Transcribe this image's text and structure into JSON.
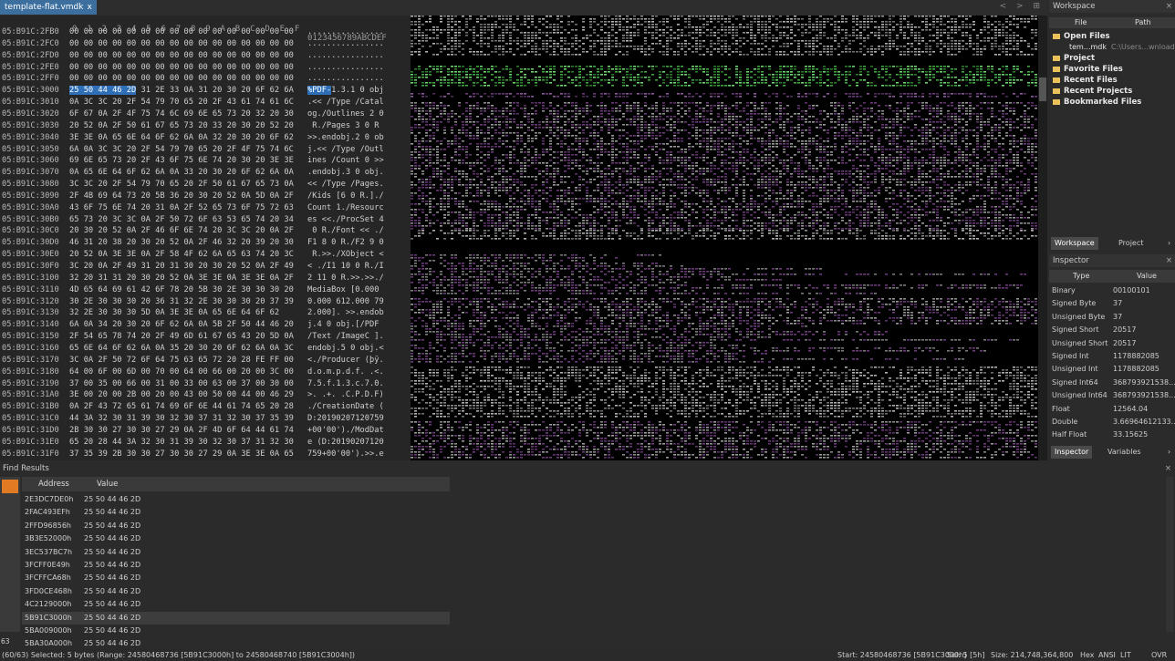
{
  "tab": {
    "title": "template-flat.vmdk",
    "close": "x"
  },
  "tab_nav": "< > ⊞",
  "editor": {
    "col_header_hex": "0  1  2  3  4  5  6  7  8  9  A  B  C  D  E  F",
    "col_header_ascii": "0123456789ABCDEF",
    "rows": [
      {
        "addr": "05:B91C:2FB0",
        "hex": "00 00 00 00 00 00 00 00 00 00 00 00 00 00 00 00",
        "ascii": "................"
      },
      {
        "addr": "05:B91C:2FC0",
        "hex": "00 00 00 00 00 00 00 00 00 00 00 00 00 00 00 00",
        "ascii": "................"
      },
      {
        "addr": "05:B91C:2FD0",
        "hex": "00 00 00 00 00 00 00 00 00 00 00 00 00 00 00 00",
        "ascii": "................"
      },
      {
        "addr": "05:B91C:2FE0",
        "hex": "00 00 00 00 00 00 00 00 00 00 00 00 00 00 00 00",
        "ascii": "................"
      },
      {
        "addr": "05:B91C:2FF0",
        "hex": "00 00 00 00 00 00 00 00 00 00 00 00 00 00 00 00",
        "ascii": "................"
      },
      {
        "addr": "05:B91C:3000",
        "hex_sel": "25 50 44 46 2D",
        "hex": " 31 2E 33 0A 31 20 30 20 6F 62 6A",
        "ascii_sel": "%PDF-",
        "ascii": "1.3.1 0 obj"
      },
      {
        "addr": "05:B91C:3010",
        "hex": "0A 3C 3C 20 2F 54 79 70 65 20 2F 43 61 74 61 6C",
        "ascii": ".<< /Type /Catal"
      },
      {
        "addr": "05:B91C:3020",
        "hex": "6F 67 0A 2F 4F 75 74 6C 69 6E 65 73 20 32 20 30",
        "ascii": "og./Outlines 2 0"
      },
      {
        "addr": "05:B91C:3030",
        "hex": "20 52 0A 2F 50 61 67 65 73 20 33 20 30 20 52 20",
        "ascii": " R./Pages 3 0 R "
      },
      {
        "addr": "05:B91C:3040",
        "hex": "3E 3E 0A 65 6E 64 6F 62 6A 0A 32 20 30 20 6F 62",
        "ascii": ">>.endobj.2 0 ob"
      },
      {
        "addr": "05:B91C:3050",
        "hex": "6A 0A 3C 3C 20 2F 54 79 70 65 20 2F 4F 75 74 6C",
        "ascii": "j.<< /Type /Outl"
      },
      {
        "addr": "05:B91C:3060",
        "hex": "69 6E 65 73 20 2F 43 6F 75 6E 74 20 30 20 3E 3E",
        "ascii": "ines /Count 0 >>"
      },
      {
        "addr": "05:B91C:3070",
        "hex": "0A 65 6E 64 6F 62 6A 0A 33 20 30 20 6F 62 6A 0A",
        "ascii": ".endobj.3 0 obj."
      },
      {
        "addr": "05:B91C:3080",
        "hex": "3C 3C 20 2F 54 79 70 65 20 2F 50 61 67 65 73 0A",
        "ascii": "<< /Type /Pages."
      },
      {
        "addr": "05:B91C:3090",
        "hex": "2F 4B 69 64 73 20 5B 36 20 30 20 52 0A 5D 0A 2F",
        "ascii": "/Kids [6 0 R.]./"
      },
      {
        "addr": "05:B91C:30A0",
        "hex": "43 6F 75 6E 74 20 31 0A 2F 52 65 73 6F 75 72 63",
        "ascii": "Count 1./Resourc"
      },
      {
        "addr": "05:B91C:30B0",
        "hex": "65 73 20 3C 3C 0A 2F 50 72 6F 63 53 65 74 20 34",
        "ascii": "es <<./ProcSet 4"
      },
      {
        "addr": "05:B91C:30C0",
        "hex": "20 30 20 52 0A 2F 46 6F 6E 74 20 3C 3C 20 0A 2F",
        "ascii": " 0 R./Font << ./"
      },
      {
        "addr": "05:B91C:30D0",
        "hex": "46 31 20 38 20 30 20 52 0A 2F 46 32 20 39 20 30",
        "ascii": "F1 8 0 R./F2 9 0"
      },
      {
        "addr": "05:B91C:30E0",
        "hex": "20 52 0A 3E 3E 0A 2F 58 4F 62 6A 65 63 74 20 3C",
        "ascii": " R.>>./XObject <"
      },
      {
        "addr": "05:B91C:30F0",
        "hex": "3C 20 0A 2F 49 31 20 31 30 20 30 20 52 0A 2F 49",
        "ascii": "< ./I1 10 0 R./I"
      },
      {
        "addr": "05:B91C:3100",
        "hex": "32 20 31 31 20 30 20 52 0A 3E 3E 0A 3E 3E 0A 2F",
        "ascii": "2 11 0 R.>>.>>./"
      },
      {
        "addr": "05:B91C:3110",
        "hex": "4D 65 64 69 61 42 6F 78 20 5B 30 2E 30 30 30 20",
        "ascii": "MediaBox [0.000 "
      },
      {
        "addr": "05:B91C:3120",
        "hex": "30 2E 30 30 30 20 36 31 32 2E 30 30 30 20 37 39",
        "ascii": "0.000 612.000 79"
      },
      {
        "addr": "05:B91C:3130",
        "hex": "32 2E 30 30 30 5D 0A 3E 3E 0A 65 6E 64 6F 62",
        "ascii": "2.000]. >>.endob"
      },
      {
        "addr": "05:B91C:3140",
        "hex": "6A 0A 34 20 30 20 6F 62 6A 0A 5B 2F 50 44 46 20",
        "ascii": "j.4 0 obj.[/PDF "
      },
      {
        "addr": "05:B91C:3150",
        "hex": "2F 54 65 78 74 20 2F 49 6D 61 67 65 43 20 5D 0A",
        "ascii": "/Text /ImageC ]."
      },
      {
        "addr": "05:B91C:3160",
        "hex": "65 6E 64 6F 62 6A 0A 35 20 30 20 6F 62 6A 0A 3C",
        "ascii": "endobj.5 0 obj.<"
      },
      {
        "addr": "05:B91C:3170",
        "hex": "3C 0A 2F 50 72 6F 64 75 63 65 72 20 28 FE FF 00",
        "ascii": "<./Producer (þÿ."
      },
      {
        "addr": "05:B91C:3180",
        "hex": "64 00 6F 00 6D 00 70 00 64 00 66 00 20 00 3C 00",
        "ascii": "d.o.m.p.d.f. .<."
      },
      {
        "addr": "05:B91C:3190",
        "hex": "37 00 35 00 66 00 31 00 33 00 63 00 37 00 30 00",
        "ascii": "7.5.f.1.3.c.7.0."
      },
      {
        "addr": "05:B91C:31A0",
        "hex": "3E 00 20 00 2B 00 20 00 43 00 50 00 44 00 46 29",
        "ascii": ">. .+. .C.P.D.F)"
      },
      {
        "addr": "05:B91C:31B0",
        "hex": "0A 2F 43 72 65 61 74 69 6F 6E 44 61 74 65 20 28",
        "ascii": "./CreationDate ("
      },
      {
        "addr": "05:B91C:31C0",
        "hex": "44 3A 32 30 31 39 30 32 30 37 31 32 30 37 35 39",
        "ascii": "D:20190207120759"
      },
      {
        "addr": "05:B91C:31D0",
        "hex": "2B 30 30 27 30 30 27 29 0A 2F 4D 6F 64 44 61 74",
        "ascii": "+00'00')./ModDat"
      },
      {
        "addr": "05:B91C:31E0",
        "hex": "65 20 28 44 3A 32 30 31 39 30 32 30 37 31 32 30",
        "ascii": "e (D:20190207120"
      },
      {
        "addr": "05:B91C:31F0",
        "hex": "37 35 39 2B 30 30 27 30 30 27 29 0A 3E 3E 0A 65",
        "ascii": "759+00'00').>>.e"
      }
    ]
  },
  "workspace": {
    "title": "Workspace",
    "col_file": "File",
    "col_path": "Path",
    "open_files_label": "Open Files",
    "open_file_name": "tem...mdk",
    "open_file_path": "C:\\Users...wnloads\\",
    "items": [
      "Project",
      "Favorite Files",
      "Recent Files",
      "Recent Projects",
      "Bookmarked Files"
    ],
    "tab_workspace": "Workspace",
    "tab_project": "Project"
  },
  "inspector": {
    "title": "Inspector",
    "col_type": "Type",
    "col_value": "Value",
    "rows": [
      {
        "type": "Binary",
        "value": "00100101"
      },
      {
        "type": "Signed Byte",
        "value": "37"
      },
      {
        "type": "Unsigned Byte",
        "value": "37"
      },
      {
        "type": "Signed Short",
        "value": "20517"
      },
      {
        "type": "Unsigned Short",
        "value": "20517"
      },
      {
        "type": "Signed Int",
        "value": "1178882085"
      },
      {
        "type": "Unsigned Int",
        "value": "1178882085"
      },
      {
        "type": "Signed Int64",
        "value": "368793921538..."
      },
      {
        "type": "Unsigned Int64",
        "value": "368793921538..."
      },
      {
        "type": "Float",
        "value": "12564.04"
      },
      {
        "type": "Double",
        "value": "3.66964612133..."
      },
      {
        "type": "Half Float",
        "value": "33.15625"
      }
    ],
    "tab_inspector": "Inspector",
    "tab_variables": "Variables"
  },
  "find": {
    "title": "Find Results",
    "col_address": "Address",
    "col_value": "Value",
    "rows": [
      {
        "address": "2E3DC7DE0h",
        "value": "25 50 44 46 2D"
      },
      {
        "address": "2FAC493EFh",
        "value": "25 50 44 46 2D"
      },
      {
        "address": "2FFD96856h",
        "value": "25 50 44 46 2D"
      },
      {
        "address": "3B3E52000h",
        "value": "25 50 44 46 2D"
      },
      {
        "address": "3EC537BC7h",
        "value": "25 50 44 46 2D"
      },
      {
        "address": "3FCFF0E49h",
        "value": "25 50 44 46 2D"
      },
      {
        "address": "3FCFFCA68h",
        "value": "25 50 44 46 2D"
      },
      {
        "address": "3FD0CE468h",
        "value": "25 50 44 46 2D"
      },
      {
        "address": "4C2129000h",
        "value": "25 50 44 46 2D"
      },
      {
        "address": "5B91C3000h",
        "value": "25 50 44 46 2D"
      },
      {
        "address": "5BA009000h",
        "value": "25 50 44 46 2D"
      },
      {
        "address": "5BA30A000h",
        "value": "25 50 44 46 2D"
      }
    ],
    "count_label": "63"
  },
  "status": {
    "left": "(60/63) Selected: 5 bytes (Range: 24580468736 [5B91C3000h] to 24580468740 [5B91C3004h])",
    "start": "Start: 24580468736 [5B91C3000h]",
    "sel": "Sel: 5 [5h]",
    "size": "Size: 214,748,364,800",
    "hex": "Hex",
    "ansi": "ANSI",
    "lit": "LIT",
    "ovr": "OVR"
  },
  "colors": {
    "selection": "#2f6fb8",
    "find_marker": "#e07b24",
    "tab_active": "#3c6e9e",
    "folder": "#e8c25a"
  }
}
